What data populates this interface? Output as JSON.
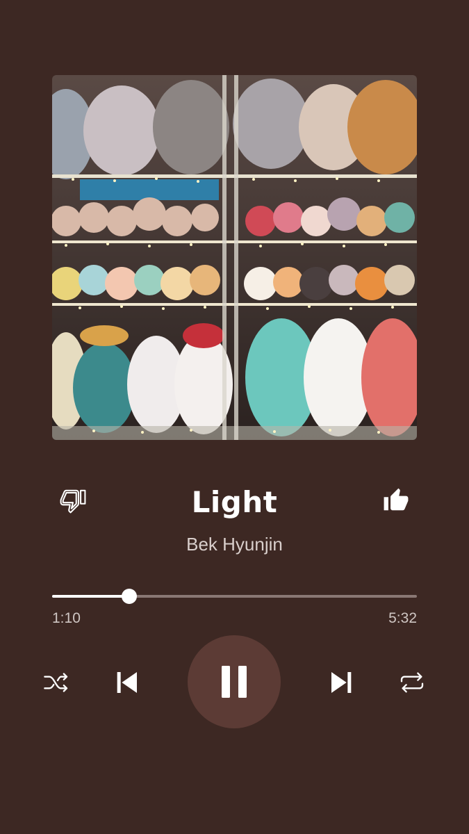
{
  "track": {
    "title": "Light",
    "artist": "Bek Hyunjin"
  },
  "playback": {
    "elapsed": "1:10",
    "duration": "5:32",
    "progress_fraction": 0.211,
    "state": "playing"
  },
  "icons": {
    "dislike": "thumbs-down-outline-icon",
    "like": "thumbs-up-filled-icon",
    "shuffle": "shuffle-icon",
    "previous": "skip-previous-icon",
    "play_pause": "pause-icon",
    "next": "skip-next-icon",
    "repeat": "repeat-icon"
  },
  "colors": {
    "background": "#3d2823",
    "play_button": "#5c3b35",
    "accent": "#ffffff"
  }
}
